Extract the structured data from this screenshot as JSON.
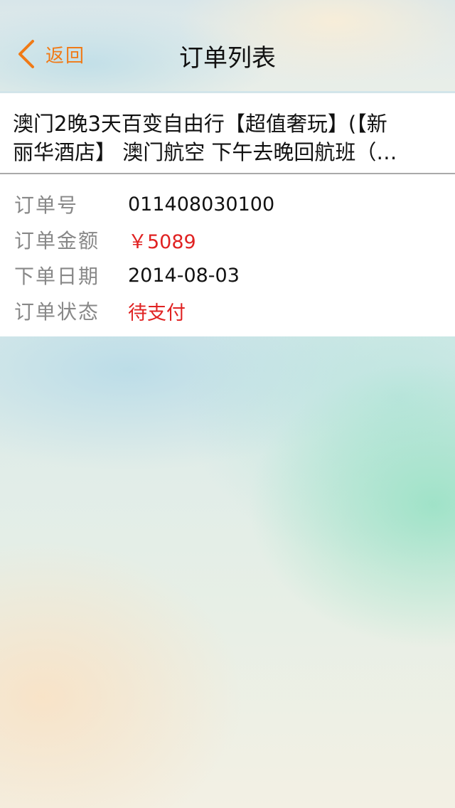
{
  "nav": {
    "back_label": "返回",
    "title": "订单列表"
  },
  "order": {
    "product_title_line1": "澳门2晚3天百变自由行【超值奢玩】(【新",
    "product_title_line2": "丽华酒店】 澳门航空 下午去晚回航班（…",
    "rows": [
      {
        "label": "订单号",
        "value": "011408030100"
      },
      {
        "label": "订单金额",
        "value": "￥5089"
      },
      {
        "label": "下单日期",
        "value": "2014-08-03"
      },
      {
        "label": "订单状态",
        "value": "待支付"
      }
    ]
  },
  "colors": {
    "accent": "#f07a16",
    "price": "#e02222",
    "status": "#e02222"
  },
  "icons": {
    "back": "chevron-left-icon"
  }
}
